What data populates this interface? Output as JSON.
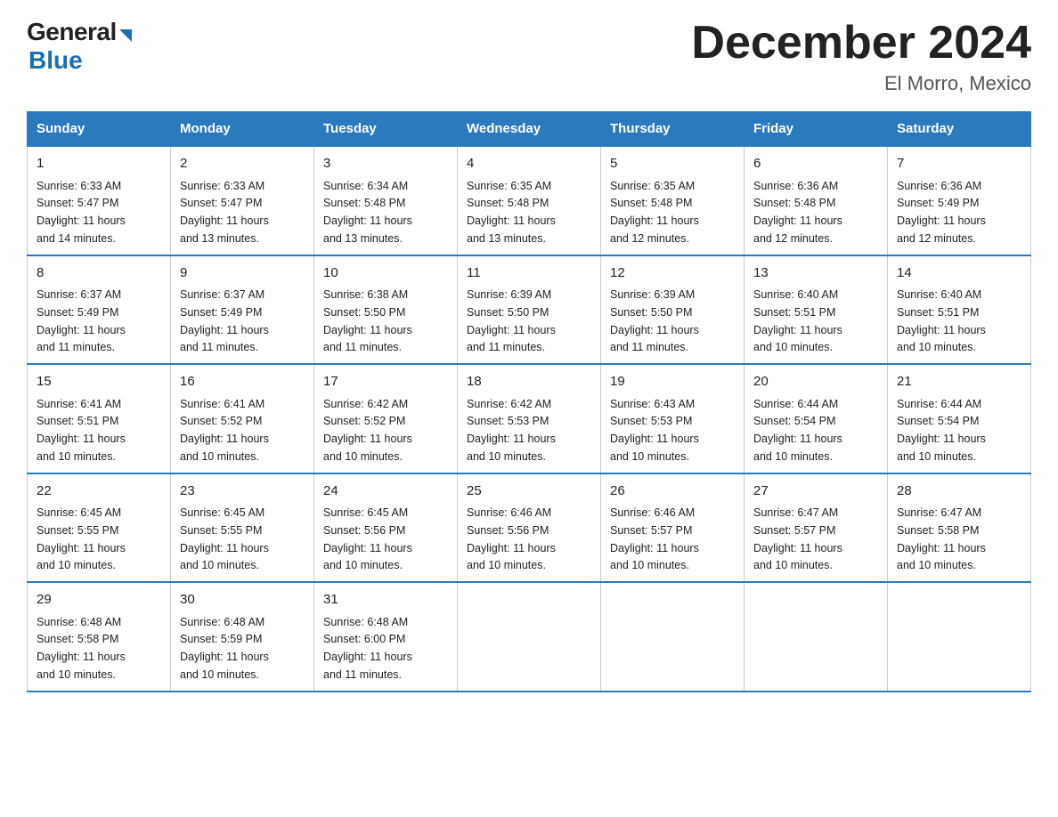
{
  "logo": {
    "general": "General",
    "blue": "Blue"
  },
  "title": "December 2024",
  "location": "El Morro, Mexico",
  "days_header": [
    "Sunday",
    "Monday",
    "Tuesday",
    "Wednesday",
    "Thursday",
    "Friday",
    "Saturday"
  ],
  "weeks": [
    [
      {
        "num": "1",
        "sunrise": "6:33 AM",
        "sunset": "5:47 PM",
        "daylight": "11 hours and 14 minutes."
      },
      {
        "num": "2",
        "sunrise": "6:33 AM",
        "sunset": "5:47 PM",
        "daylight": "11 hours and 13 minutes."
      },
      {
        "num": "3",
        "sunrise": "6:34 AM",
        "sunset": "5:48 PM",
        "daylight": "11 hours and 13 minutes."
      },
      {
        "num": "4",
        "sunrise": "6:35 AM",
        "sunset": "5:48 PM",
        "daylight": "11 hours and 13 minutes."
      },
      {
        "num": "5",
        "sunrise": "6:35 AM",
        "sunset": "5:48 PM",
        "daylight": "11 hours and 12 minutes."
      },
      {
        "num": "6",
        "sunrise": "6:36 AM",
        "sunset": "5:48 PM",
        "daylight": "11 hours and 12 minutes."
      },
      {
        "num": "7",
        "sunrise": "6:36 AM",
        "sunset": "5:49 PM",
        "daylight": "11 hours and 12 minutes."
      }
    ],
    [
      {
        "num": "8",
        "sunrise": "6:37 AM",
        "sunset": "5:49 PM",
        "daylight": "11 hours and 11 minutes."
      },
      {
        "num": "9",
        "sunrise": "6:37 AM",
        "sunset": "5:49 PM",
        "daylight": "11 hours and 11 minutes."
      },
      {
        "num": "10",
        "sunrise": "6:38 AM",
        "sunset": "5:50 PM",
        "daylight": "11 hours and 11 minutes."
      },
      {
        "num": "11",
        "sunrise": "6:39 AM",
        "sunset": "5:50 PM",
        "daylight": "11 hours and 11 minutes."
      },
      {
        "num": "12",
        "sunrise": "6:39 AM",
        "sunset": "5:50 PM",
        "daylight": "11 hours and 11 minutes."
      },
      {
        "num": "13",
        "sunrise": "6:40 AM",
        "sunset": "5:51 PM",
        "daylight": "11 hours and 10 minutes."
      },
      {
        "num": "14",
        "sunrise": "6:40 AM",
        "sunset": "5:51 PM",
        "daylight": "11 hours and 10 minutes."
      }
    ],
    [
      {
        "num": "15",
        "sunrise": "6:41 AM",
        "sunset": "5:51 PM",
        "daylight": "11 hours and 10 minutes."
      },
      {
        "num": "16",
        "sunrise": "6:41 AM",
        "sunset": "5:52 PM",
        "daylight": "11 hours and 10 minutes."
      },
      {
        "num": "17",
        "sunrise": "6:42 AM",
        "sunset": "5:52 PM",
        "daylight": "11 hours and 10 minutes."
      },
      {
        "num": "18",
        "sunrise": "6:42 AM",
        "sunset": "5:53 PM",
        "daylight": "11 hours and 10 minutes."
      },
      {
        "num": "19",
        "sunrise": "6:43 AM",
        "sunset": "5:53 PM",
        "daylight": "11 hours and 10 minutes."
      },
      {
        "num": "20",
        "sunrise": "6:44 AM",
        "sunset": "5:54 PM",
        "daylight": "11 hours and 10 minutes."
      },
      {
        "num": "21",
        "sunrise": "6:44 AM",
        "sunset": "5:54 PM",
        "daylight": "11 hours and 10 minutes."
      }
    ],
    [
      {
        "num": "22",
        "sunrise": "6:45 AM",
        "sunset": "5:55 PM",
        "daylight": "11 hours and 10 minutes."
      },
      {
        "num": "23",
        "sunrise": "6:45 AM",
        "sunset": "5:55 PM",
        "daylight": "11 hours and 10 minutes."
      },
      {
        "num": "24",
        "sunrise": "6:45 AM",
        "sunset": "5:56 PM",
        "daylight": "11 hours and 10 minutes."
      },
      {
        "num": "25",
        "sunrise": "6:46 AM",
        "sunset": "5:56 PM",
        "daylight": "11 hours and 10 minutes."
      },
      {
        "num": "26",
        "sunrise": "6:46 AM",
        "sunset": "5:57 PM",
        "daylight": "11 hours and 10 minutes."
      },
      {
        "num": "27",
        "sunrise": "6:47 AM",
        "sunset": "5:57 PM",
        "daylight": "11 hours and 10 minutes."
      },
      {
        "num": "28",
        "sunrise": "6:47 AM",
        "sunset": "5:58 PM",
        "daylight": "11 hours and 10 minutes."
      }
    ],
    [
      {
        "num": "29",
        "sunrise": "6:48 AM",
        "sunset": "5:58 PM",
        "daylight": "11 hours and 10 minutes."
      },
      {
        "num": "30",
        "sunrise": "6:48 AM",
        "sunset": "5:59 PM",
        "daylight": "11 hours and 10 minutes."
      },
      {
        "num": "31",
        "sunrise": "6:48 AM",
        "sunset": "6:00 PM",
        "daylight": "11 hours and 11 minutes."
      },
      null,
      null,
      null,
      null
    ]
  ],
  "sunrise_label": "Sunrise:",
  "sunset_label": "Sunset:",
  "daylight_label": "Daylight:"
}
